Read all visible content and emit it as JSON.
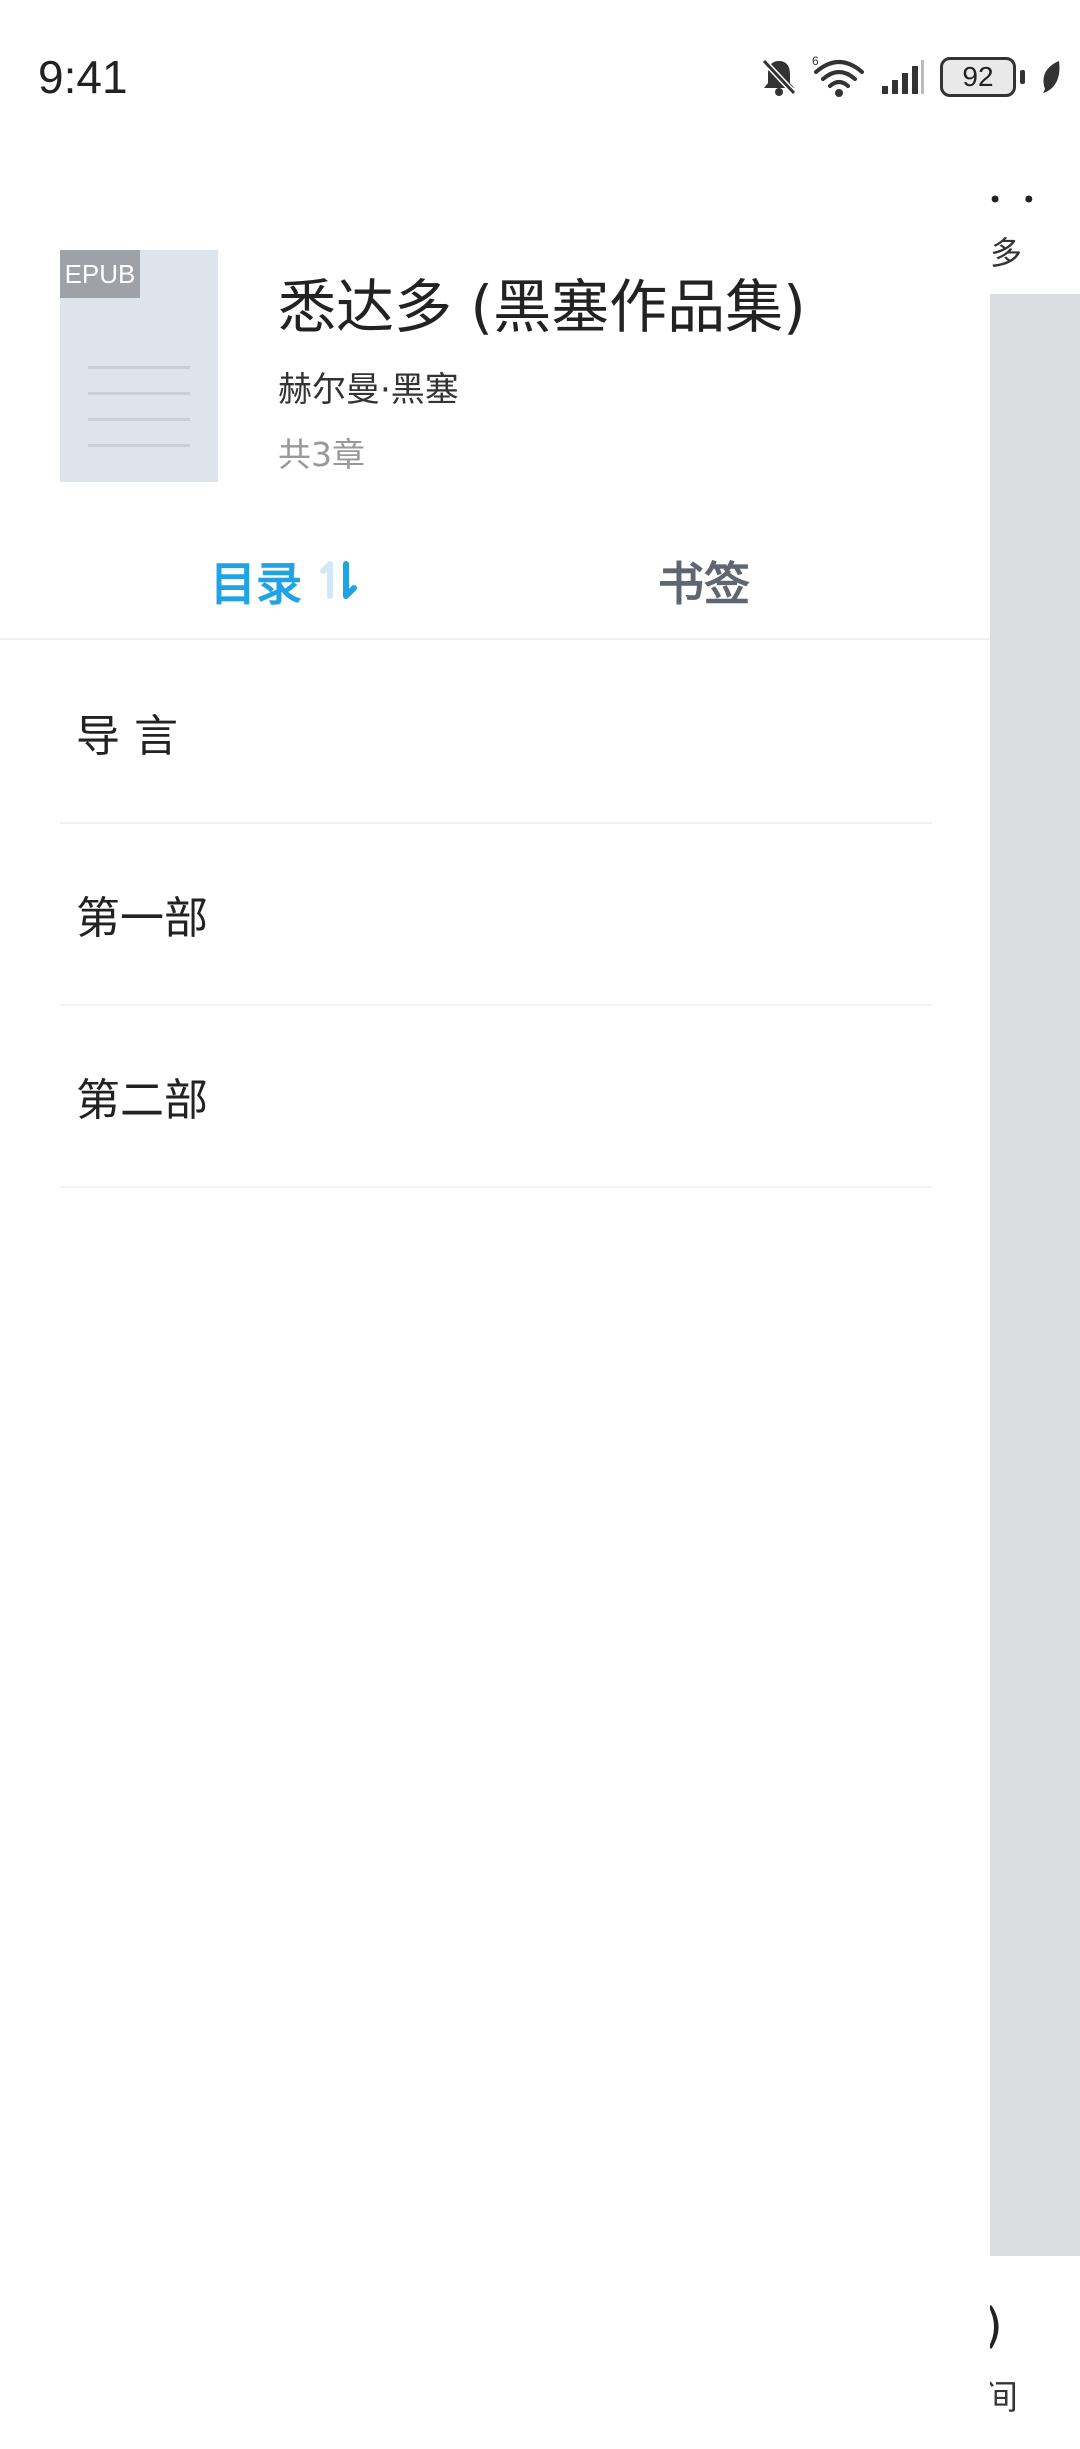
{
  "status_bar": {
    "time": "9:41",
    "battery_level": "92",
    "icons": [
      "bell-muted-icon",
      "wifi-icon",
      "signal-icon",
      "battery-icon",
      "leaf-icon"
    ]
  },
  "background_page": {
    "dots": "• •",
    "title_fragment": "多",
    "fragment_a": ")",
    "fragment_b": "间"
  },
  "book": {
    "format_badge": "EPUB",
    "title": "悉达多 (黑塞作品集)",
    "author": "赫尔曼·黑塞",
    "chapter_count": "共3章"
  },
  "tabs": {
    "toc_label": "目录",
    "bookmark_label": "书签",
    "active": "toc"
  },
  "chapters": [
    {
      "label": "导 言"
    },
    {
      "label": "第一部"
    },
    {
      "label": "第二部"
    }
  ],
  "colors": {
    "accent": "#1fa3e6",
    "tab_inactive": "#5f6670",
    "cover_bg": "#dee4ec",
    "badge_bg": "#9ea2a8"
  }
}
